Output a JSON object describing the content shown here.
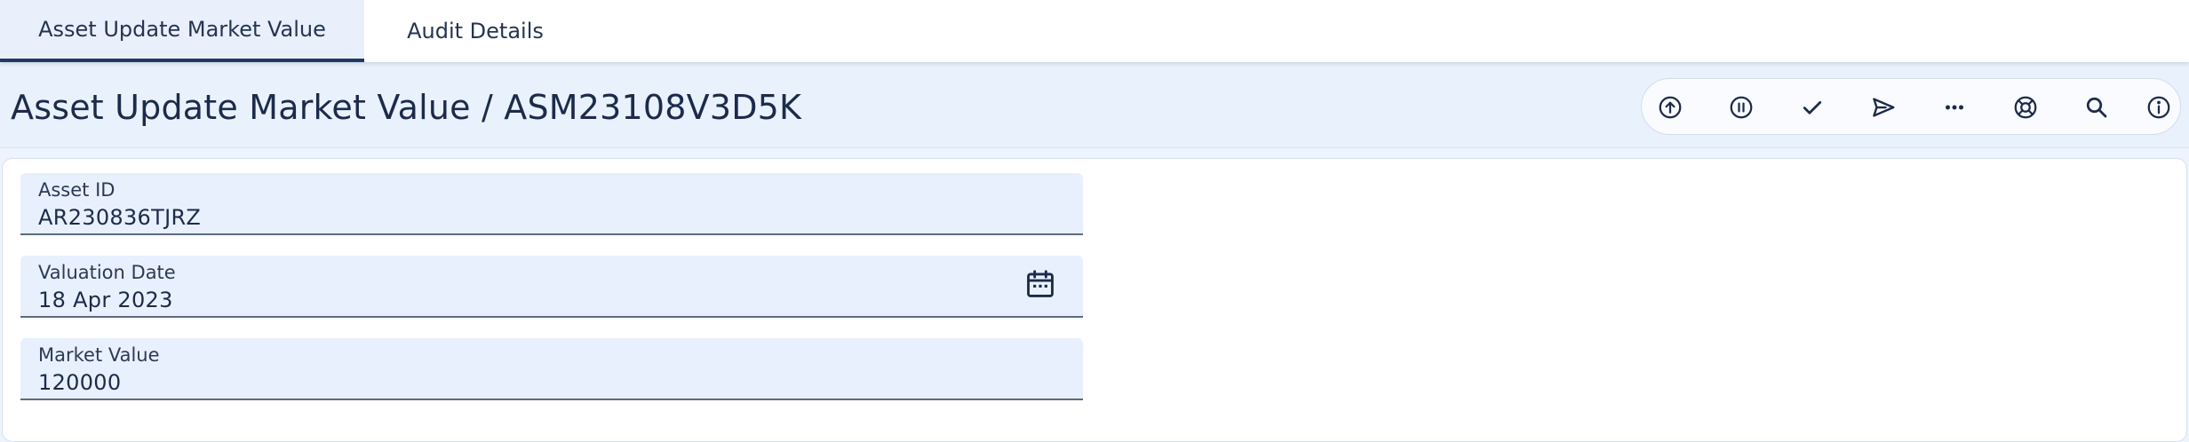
{
  "tabs": [
    {
      "label": "Asset Update Market Value",
      "active": true
    },
    {
      "label": "Audit Details",
      "active": false
    }
  ],
  "header": {
    "title": "Asset Update Market Value / ASM23108V3D5K"
  },
  "toolbar": {
    "icons": [
      "upload-icon",
      "pause-icon",
      "check-icon",
      "send-icon",
      "more-icon",
      "lifebuoy-icon",
      "search-icon",
      "info-icon"
    ]
  },
  "form": {
    "asset_id": {
      "label": "Asset ID",
      "value": "AR230836TJRZ"
    },
    "valuation_date": {
      "label": "Valuation Date",
      "value": "18 Apr 2023"
    },
    "market_value": {
      "label": "Market Value",
      "value": "120000"
    }
  },
  "colors": {
    "accent": "#1e3a66",
    "header_bg": "#e9f1fc",
    "field_bg": "#e8f0fd",
    "text": "#1c2b4a"
  }
}
